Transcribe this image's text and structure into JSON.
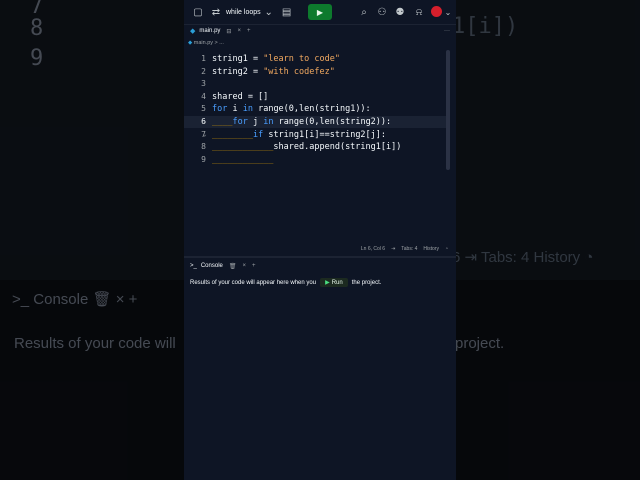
{
  "background": {
    "line_numbers": [
      "7",
      "8",
      "9"
    ],
    "code_fragment": "1[i])",
    "status": "6  ⇥  Tabs: 4   History  ◔",
    "console_label": "Console",
    "console_text_left": "Results of your code will",
    "console_text_right": "project."
  },
  "topbar": {
    "repl_name": "while loops",
    "run_icon": "play-icon"
  },
  "tabs": [
    {
      "label": "main.py"
    }
  ],
  "breadcrumb": "main.py > ...",
  "editor": {
    "lines": [
      {
        "n": "1",
        "code": "string1 = \"learn to code\""
      },
      {
        "n": "2",
        "code": "string2 = \"with codefez\""
      },
      {
        "n": "3",
        "code": ""
      },
      {
        "n": "4",
        "code": "shared = []"
      },
      {
        "n": "5",
        "code": "for i in range(0,len(string1)):"
      },
      {
        "n": "6",
        "code": "    for j in range(0,len(string2)):"
      },
      {
        "n": "7",
        "code": "        if string1[i]==string2[j]:"
      },
      {
        "n": "8",
        "code": "            shared.append(string1[i])"
      },
      {
        "n": "9",
        "code": "            "
      }
    ],
    "cursor": "Ln 6, Col 6",
    "tabs": "Tabs: 4",
    "history": "History"
  },
  "console": {
    "tab_label": "Console",
    "message_before": "Results of your code will appear here when you",
    "run_label": "Run",
    "message_after": "the project."
  },
  "colors": {
    "run_green": "#0d7a2d",
    "avatar_red": "#d61f2c",
    "keyword_blue": "#4a9eff",
    "string_orange": "#f0a860"
  }
}
